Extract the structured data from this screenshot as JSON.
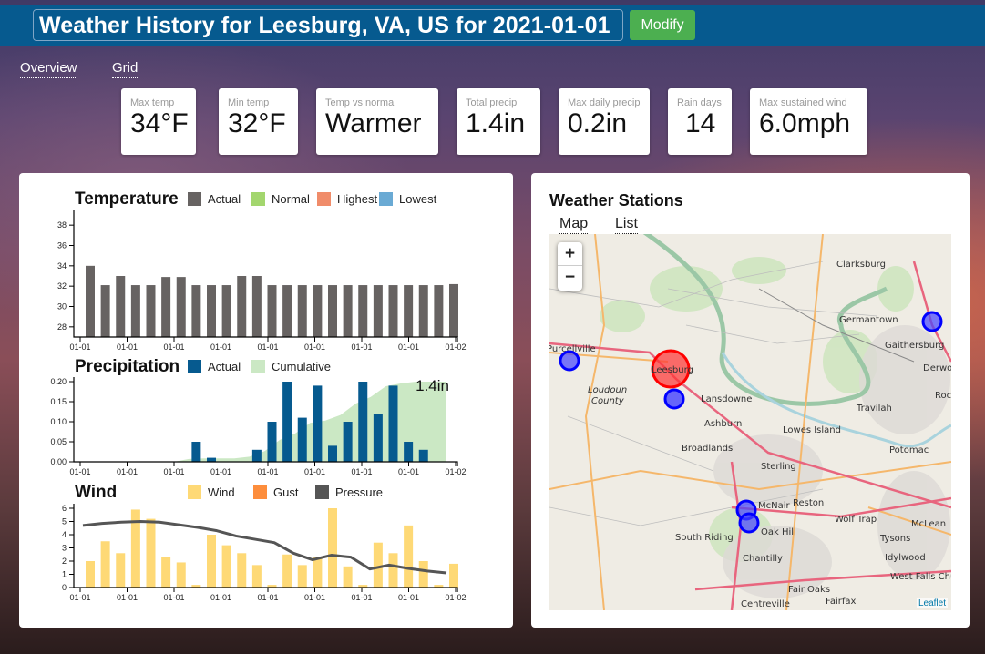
{
  "header": {
    "title": "Weather History for Leesburg, VA, US for 2021-01-01",
    "modify_label": "Modify"
  },
  "nav": {
    "tabs": [
      {
        "label": "Overview"
      },
      {
        "label": "Grid"
      }
    ]
  },
  "stats": [
    {
      "label": "Max temp",
      "value": "34°F"
    },
    {
      "label": "Min temp",
      "value": "32°F"
    },
    {
      "label": "Temp vs normal",
      "value": "Warmer"
    },
    {
      "label": "Total precip",
      "value": "1.4in"
    },
    {
      "label": "Max daily precip",
      "value": "0.2in"
    },
    {
      "label": "Rain days",
      "value": "14"
    },
    {
      "label": "Max sustained wind",
      "value": "6.0mph"
    }
  ],
  "chart_data": [
    {
      "type": "bar",
      "title": "Temperature",
      "legend": [
        {
          "name": "Actual",
          "color": "#676362"
        },
        {
          "name": "Normal",
          "color": "#a3d66e"
        },
        {
          "name": "Highest",
          "color": "#f08c6a"
        },
        {
          "name": "Lowest",
          "color": "#6aaad4"
        }
      ],
      "ylim": [
        27,
        39
      ],
      "yticks": [
        28,
        30,
        32,
        34,
        36,
        38
      ],
      "xtick_labels": [
        "01-01",
        "01-01",
        "01-01",
        "01-01",
        "01-01",
        "01-01",
        "01-01",
        "01-01",
        "01-02"
      ],
      "series": [
        {
          "name": "Actual",
          "values": [
            34,
            32.1,
            33,
            32.1,
            32.1,
            32.9,
            32.9,
            32.1,
            32.1,
            32.1,
            33,
            33,
            32.1,
            32.1,
            32.1,
            32.1,
            32.1,
            32.1,
            32.1,
            32.1,
            32.1,
            32.1,
            32.1,
            32.1,
            32.2
          ]
        }
      ],
      "xlabel": "",
      "ylabel": ""
    },
    {
      "type": "bar",
      "title": "Precipitation",
      "legend": [
        {
          "name": "Actual",
          "color": "#065a8f"
        },
        {
          "name": "Cumulative",
          "color": "#cbe8c4"
        }
      ],
      "ylim": [
        0,
        0.2
      ],
      "yticks": [
        0.0,
        0.05,
        0.1,
        0.15,
        0.2
      ],
      "ytick_labels": [
        "0.00",
        "0.05",
        "0.10",
        "0.15",
        "0.20"
      ],
      "xtick_labels": [
        "01-01",
        "01-01",
        "01-01",
        "01-01",
        "01-01",
        "01-01",
        "01-01",
        "01-01",
        "01-02"
      ],
      "series": [
        {
          "name": "Actual",
          "values": [
            0,
            0,
            0,
            0,
            0,
            0,
            0,
            0.05,
            0.01,
            0,
            0,
            0.03,
            0.1,
            0.2,
            0.11,
            0.19,
            0.04,
            0.1,
            0.2,
            0.12,
            0.19,
            0.05,
            0.03,
            0,
            0
          ]
        },
        {
          "name": "Cumulative",
          "total": 1.4
        }
      ],
      "annotation": "1.4in",
      "xlabel": "",
      "ylabel": ""
    },
    {
      "type": "bar",
      "title": "Wind",
      "legend": [
        {
          "name": "Wind",
          "color": "#fed976"
        },
        {
          "name": "Gust",
          "color": "#fd8d3c"
        },
        {
          "name": "Pressure",
          "color": "#555555"
        }
      ],
      "ylim": [
        0,
        6
      ],
      "yticks": [
        0,
        1,
        2,
        3,
        4,
        5,
        6
      ],
      "xtick_labels": [
        "01-01",
        "01-01",
        "01-01",
        "01-01",
        "01-01",
        "01-01",
        "01-01",
        "01-01",
        "01-02"
      ],
      "series": [
        {
          "name": "Wind",
          "values": [
            2.0,
            3.5,
            2.6,
            5.9,
            5.2,
            2.3,
            1.9,
            0.2,
            4.0,
            3.2,
            2.6,
            1.7,
            0.2,
            2.5,
            1.7,
            2.3,
            6.0,
            1.6,
            0.2,
            3.4,
            2.6,
            4.7,
            2.0,
            0.2,
            1.8
          ]
        },
        {
          "name": "Pressure",
          "type": "line",
          "values": [
            4.7,
            4.85,
            4.95,
            5.0,
            4.95,
            4.75,
            4.55,
            4.3,
            3.9,
            3.65,
            3.4,
            2.6,
            2.1,
            2.45,
            2.3,
            1.4,
            1.7,
            1.45,
            1.25,
            1.1
          ]
        }
      ],
      "xlabel": "",
      "ylabel": ""
    }
  ],
  "stations": {
    "title": "Weather Stations",
    "tabs": [
      {
        "label": "Map"
      },
      {
        "label": "List"
      }
    ],
    "zoom_in": "+",
    "zoom_out": "−",
    "attribution": "Leaflet",
    "places": [
      "Clarksburg",
      "Germantown",
      "Gaithersburg",
      "Derwood",
      "Rockville",
      "Purcellville",
      "Leesburg",
      "Loudoun County",
      "Lansdowne",
      "Travilah",
      "Ashburn",
      "Lowes Island",
      "Broadlands",
      "Potomac",
      "Sterling",
      "McNair",
      "Reston",
      "Wolf Trap",
      "McLean",
      "Oak Hill",
      "Tysons",
      "South Riding",
      "Chantilly",
      "Idylwood",
      "West Falls Church",
      "Fair Oaks",
      "Fairfax",
      "Centreville"
    ],
    "colors": {
      "primary": "#ff0000",
      "station": "#0000ff"
    }
  }
}
